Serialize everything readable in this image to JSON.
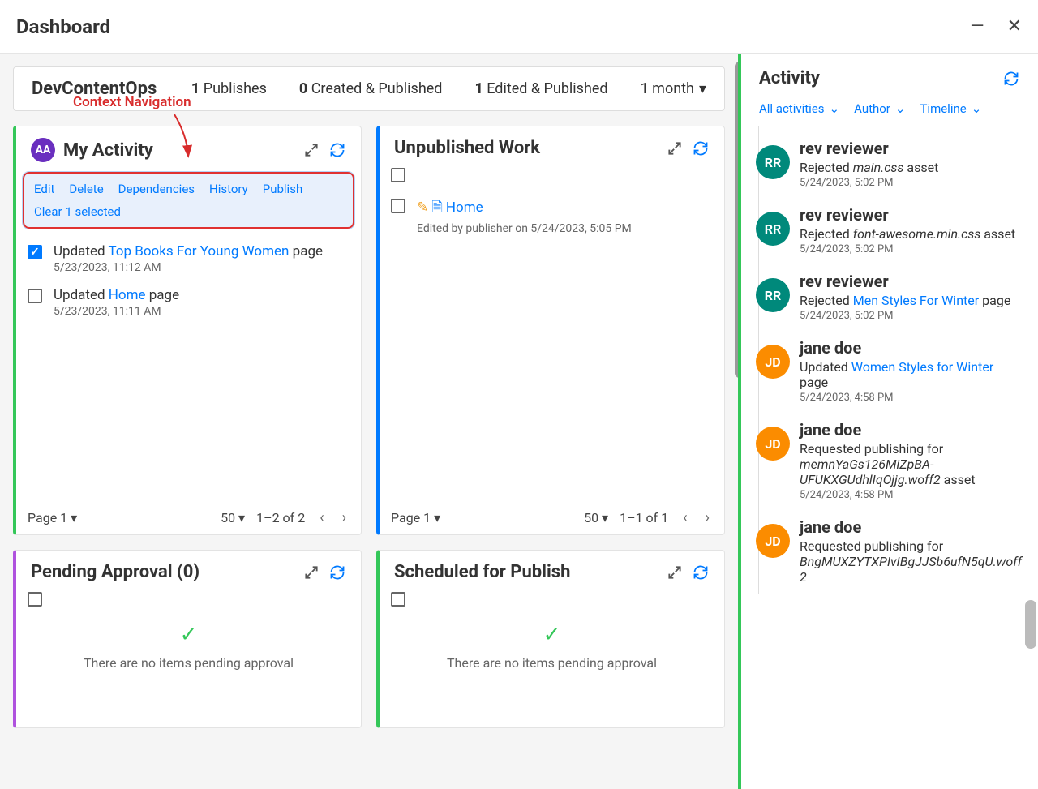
{
  "window": {
    "title": "Dashboard"
  },
  "annotation": {
    "label": "Context Navigation"
  },
  "summary": {
    "site_name": "DevContentOps",
    "publishes": {
      "count": "1",
      "label": " Publishes"
    },
    "created": {
      "count": "0",
      "label": " Created & Published"
    },
    "edited": {
      "count": "1",
      "label": " Edited & Published"
    },
    "range": "1 month"
  },
  "my_activity": {
    "title": "My Activity",
    "avatar": "AA",
    "context": {
      "actions": [
        "Edit",
        "Delete",
        "Dependencies",
        "History",
        "Publish"
      ],
      "clear": "Clear 1 selected"
    },
    "items": [
      {
        "checked": true,
        "prefix": "Updated ",
        "link_text": "Top Books For Young Women",
        "suffix": " page",
        "meta": "5/23/2023, 11:12 AM"
      },
      {
        "checked": false,
        "prefix": "Updated ",
        "link_text": "Home",
        "suffix": " page",
        "meta": "5/23/2023, 11:11 AM"
      }
    ],
    "pager": {
      "page": "Page 1",
      "size": "50",
      "range": "1–2 of 2"
    }
  },
  "unpublished": {
    "title": "Unpublished Work",
    "items": [
      {
        "link_text": "Home",
        "meta": "Edited by publisher on 5/24/2023, 5:05 PM"
      }
    ],
    "pager": {
      "page": "Page 1",
      "size": "50",
      "range": "1–1 of 1"
    }
  },
  "pending": {
    "title": "Pending Approval (0)",
    "empty_text": "There are no items pending approval"
  },
  "scheduled": {
    "title": "Scheduled for Publish",
    "empty_text": "There are no items pending approval"
  },
  "activity": {
    "title": "Activity",
    "filters": {
      "f1": "All activities",
      "f2": "Author",
      "f3": "Timeline"
    },
    "feed": [
      {
        "avatar": "RR",
        "avatar_class": "rr",
        "user": "rev reviewer",
        "html_type": "italic_asset",
        "prefix": "Rejected ",
        "italic": "main.css",
        "suffix": " asset",
        "ts": "5/24/2023, 5:02 PM"
      },
      {
        "avatar": "RR",
        "avatar_class": "rr",
        "user": "rev reviewer",
        "html_type": "italic_asset",
        "prefix": "Rejected ",
        "italic": "font-awesome.min.css",
        "suffix": " asset",
        "ts": "5/24/2023, 5:02 PM"
      },
      {
        "avatar": "RR",
        "avatar_class": "rr",
        "user": "rev reviewer",
        "html_type": "link_page",
        "prefix": "Rejected ",
        "link": "Men Styles For Winter",
        "suffix": " page",
        "ts": "5/24/2023, 5:02 PM"
      },
      {
        "avatar": "JD",
        "avatar_class": "jd",
        "user": "jane doe",
        "html_type": "link_page",
        "prefix": "Updated ",
        "link": "Women Styles for Winter",
        "suffix": " page",
        "ts": "5/24/2023, 4:58 PM"
      },
      {
        "avatar": "JD",
        "avatar_class": "jd",
        "user": "jane doe",
        "html_type": "italic_asset",
        "prefix": "Requested publishing for ",
        "italic": "memnYaGs126MiZpBA-UFUKXGUdhlIqOjjg.woff2",
        "suffix": " asset",
        "ts": "5/24/2023, 4:58 PM"
      },
      {
        "avatar": "JD",
        "avatar_class": "jd",
        "user": "jane doe",
        "html_type": "italic_asset_cut",
        "prefix": "Requested publishing for ",
        "italic": "BngMUXZYTXPIvIBgJJSb6ufN5qU.woff2",
        "suffix": "",
        "ts": ""
      }
    ]
  }
}
